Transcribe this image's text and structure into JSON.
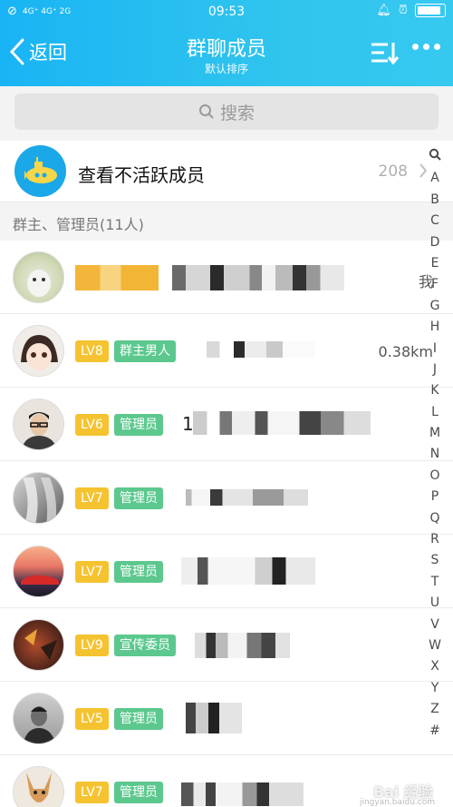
{
  "status_bar": {
    "network": "4G⁺ 4G⁺ 2G",
    "time": "09:53",
    "battery_level": 0.9
  },
  "header": {
    "back_label": "返回",
    "title": "群聊成员",
    "subtitle": "默认排序"
  },
  "search": {
    "placeholder": "搜索"
  },
  "inactive_members": {
    "label": "查看不活跃成员",
    "count": "208"
  },
  "section": {
    "label": "群主、管理员(11人)"
  },
  "members": [
    {
      "level": "",
      "role": "",
      "name_fragment": "",
      "right_text": "我"
    },
    {
      "level": "LV8",
      "role": "群主男人",
      "name_fragment": "",
      "right_text": "0.38km"
    },
    {
      "level": "LV6",
      "role": "管理员",
      "name_fragment": "1",
      "right_text": ""
    },
    {
      "level": "LV7",
      "role": "管理员",
      "name_fragment": "",
      "right_text": ""
    },
    {
      "level": "LV7",
      "role": "管理员",
      "name_fragment": "",
      "right_text": ""
    },
    {
      "level": "LV9",
      "role": "宣传委员",
      "name_fragment": "",
      "right_text": ""
    },
    {
      "level": "LV5",
      "role": "管理员",
      "name_fragment": "",
      "right_text": ""
    },
    {
      "level": "LV7",
      "role": "管理员",
      "name_fragment": "",
      "right_text": ""
    }
  ],
  "index_letters": [
    "A",
    "B",
    "C",
    "D",
    "E",
    "F",
    "G",
    "H",
    "I",
    "J",
    "K",
    "L",
    "M",
    "N",
    "O",
    "P",
    "Q",
    "R",
    "S",
    "T",
    "U",
    "V",
    "W",
    "X",
    "Y",
    "Z",
    "#"
  ],
  "colors": {
    "header_bg": "#1db7f4",
    "level_badge": "#f5c330",
    "role_badge": "#5cc88e"
  },
  "watermark": {
    "text": "Bai 经验",
    "url": "jingyan.baidu.com"
  }
}
